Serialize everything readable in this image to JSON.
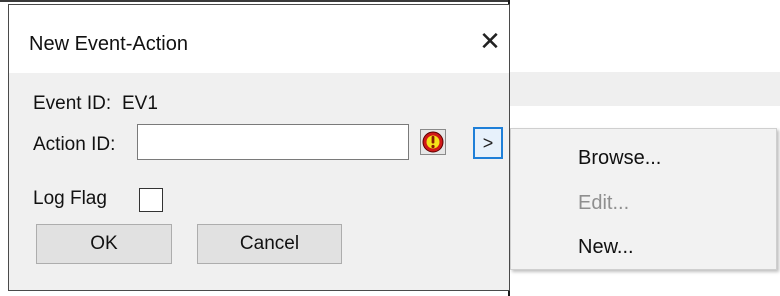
{
  "dialog": {
    "title": "New Event-Action",
    "close_glyph": "✕",
    "event_id_label": "Event ID:",
    "event_id_value": "EV1",
    "action_id_label": "Action ID:",
    "action_id_value": "",
    "more_glyph": ">",
    "warning_icon": "warning-icon",
    "log_flag_label": "Log Flag",
    "log_flag_checked": false,
    "ok_label": "OK",
    "cancel_label": "Cancel"
  },
  "context_menu": {
    "items": [
      {
        "label": "Browse...",
        "enabled": true
      },
      {
        "label": "Edit...",
        "enabled": false
      },
      {
        "label": "New...",
        "enabled": true
      }
    ]
  },
  "colors": {
    "accent": "#1e7fd8",
    "warning_red": "#d01818",
    "warning_yellow": "#f4e21a"
  }
}
